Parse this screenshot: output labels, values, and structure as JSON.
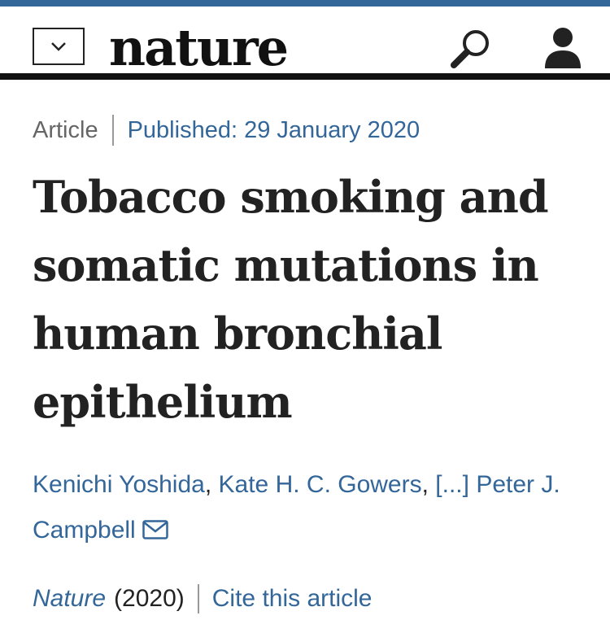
{
  "header": {
    "logo": "nature"
  },
  "article": {
    "type": "Article",
    "published": "Published: 29 January 2020",
    "title": "Tobacco smoking and somatic mutations in human bronchial epithelium",
    "authors": [
      "Kenichi Yoshida",
      "Kate H. C. Gowers",
      "[...]",
      "Peter J. Campbell"
    ],
    "journal": "Nature",
    "year": "(2020)",
    "cite_label": "Cite this article"
  },
  "colors": {
    "brand_blue": "#336699",
    "text": "#222222"
  },
  "icons": [
    "chevron-down-icon",
    "search-icon",
    "account-icon",
    "mail-icon"
  ]
}
